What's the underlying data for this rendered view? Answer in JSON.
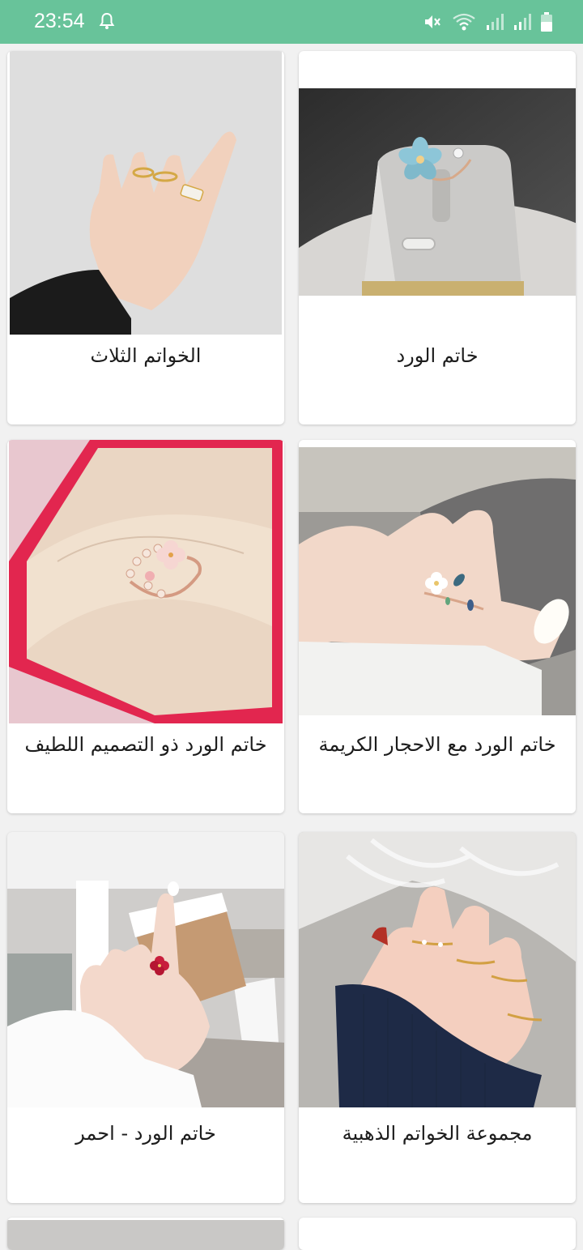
{
  "status_bar": {
    "time": "23:54",
    "icons": [
      "notification-bell-icon",
      "mute-icon",
      "wifi-icon",
      "signal-icon",
      "signal-icon",
      "battery-icon"
    ]
  },
  "products": [
    {
      "title": "خاتم الورد",
      "image": "flower-ring-on-display-stand"
    },
    {
      "title": "الخواتم الثلاث",
      "image": "hand-with-three-rings"
    },
    {
      "title": "خاتم الورد مع الاحجار الكريمة",
      "image": "hand-flower-ring-with-gems"
    },
    {
      "title": "خاتم الورد ذو التصميم اللطيف",
      "image": "flower-ring-in-red-box"
    },
    {
      "title": "مجموعة الخواتم الذهبية",
      "image": "hand-with-gold-ring-set"
    },
    {
      "title": "خاتم الورد - احمر",
      "image": "hand-with-red-flower-ring-and-cup"
    }
  ],
  "colors": {
    "status_bar": "#68c39a",
    "background": "#f1f1f1",
    "card": "#ffffff"
  }
}
